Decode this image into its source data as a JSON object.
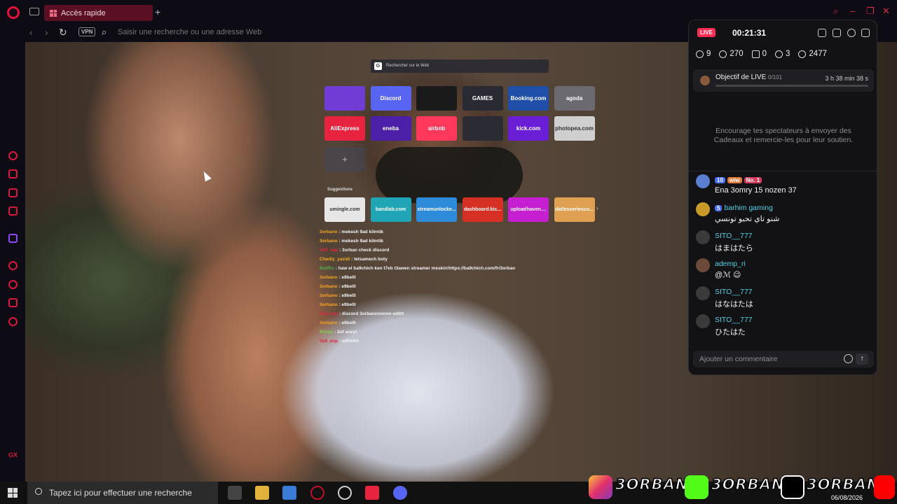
{
  "browser": {
    "tab_title": "Accès rapide",
    "new_tab": "+",
    "vpn": "VPN",
    "address_placeholder": "Saisir une recherche ou une adresse Web",
    "gx_label": "GX"
  },
  "speed_dial": {
    "search_text": "Rechercher sur le Web",
    "search_engine_glyph": "G",
    "tiles_row1": [
      {
        "label": "",
        "color": "#6f3cd6"
      },
      {
        "label": "Discord",
        "color": "#5865f2"
      },
      {
        "label": "",
        "color": "#1a1a1a"
      },
      {
        "label": "GAMES",
        "color": "#2a2a33"
      },
      {
        "label": "Booking.com",
        "color": "#1f4fa8"
      },
      {
        "label": "agoda",
        "color": "#6a6a70"
      }
    ],
    "tiles_row2": [
      {
        "label": "AliExpress",
        "color": "#e8233f"
      },
      {
        "label": "eneba",
        "color": "#4b1fa8"
      },
      {
        "label": "airbnb",
        "color": "#ff385c"
      },
      {
        "label": "",
        "color": "#2b2b33"
      },
      {
        "label": "kick.com",
        "color": "#6a1fd6"
      },
      {
        "label": "photopea.com",
        "color": "#cfcfcf"
      }
    ],
    "add_label": "+",
    "suggestions_label": "Suggestions",
    "suggestions": [
      {
        "label": "umingle.com",
        "color": "#e6e6e6"
      },
      {
        "label": "bandlab.com",
        "color": "#1fa5b5"
      },
      {
        "label": "streamunlocke...",
        "color": "#2e8bd9"
      },
      {
        "label": "dashboard.kic...",
        "color": "#d63024"
      },
      {
        "label": "uploadhaven....",
        "color": "#c51fd1"
      },
      {
        "label": "datlesseriesco...",
        "color": "#e0a052"
      }
    ],
    "next_arrow": "›"
  },
  "overlay_chat": [
    {
      "user": "3orbano",
      "user_color": "#f5a623",
      "text": ": mekesh 9ad kilmtik"
    },
    {
      "user": "3orbano",
      "user_color": "#f5a623",
      "text": ": mekesh 9ad kilmtik"
    },
    {
      "user": "Yefi_sep",
      "user_color": "#e8233f",
      "text": ": 3orban check discord"
    },
    {
      "user": "Chedly_yazidi",
      "user_color": "#f5a623",
      "text": ": tetsamech boty"
    },
    {
      "user": "BotRix",
      "user_color": "#4caf50",
      "text": ": haw el ba9chich ken t7eb t3awen streamer meskin!https://ba9chich.com/fr/3orban"
    },
    {
      "user": "3orbano",
      "user_color": "#f5a623",
      "text": ": e9belll"
    },
    {
      "user": "3orbano",
      "user_color": "#f5a623",
      "text": ": e9belll"
    },
    {
      "user": "3orbano",
      "user_color": "#f5a623",
      "text": ": e9belll"
    },
    {
      "user": "3orbano",
      "user_color": "#f5a623",
      "text": ": e9belll"
    },
    {
      "user": "Vell_esp",
      "user_color": "#e8233f",
      "text": ": discord 3orbannnnnnn edittt"
    },
    {
      "user": "3orbano",
      "user_color": "#f5a623",
      "text": ": e9belll"
    },
    {
      "user": "fkmsp",
      "user_color": "#7bd64a",
      "text": ": 3of aneyt"
    },
    {
      "user": "Vell_esp",
      "user_color": "#e8233f",
      "text": ": wllhhhh"
    }
  ],
  "live": {
    "badge": "LIVE",
    "timer": "00:21:31",
    "stats": {
      "viewers_a": "9",
      "views": "270",
      "gifts": "0",
      "shares": "3",
      "likes": "2477"
    },
    "goal": {
      "label": "Objectif de LIVE",
      "count": "0/101",
      "remaining": "3 h 38 min 38 s",
      "progress": 0.0
    },
    "encourage_text": "Encourage tes spectateurs à envoyer des Cadeaux et remercie-les pour leur soutien.",
    "comments": [
      {
        "name": "",
        "badges": [
          "10",
          "wiw",
          "No. 1"
        ],
        "msg": "Ena 3omry 15 nozen 37",
        "avatar_color": "#5a7fd0"
      },
      {
        "name": "barhim gaming",
        "badges": [
          "5"
        ],
        "msg": "شنو تاي تحبو تونسي",
        "avatar_color": "#c79a2a"
      },
      {
        "name": "SITO__777",
        "badges": [],
        "msg": "はまはたら",
        "avatar_color": "#3a3a3a"
      },
      {
        "name": "ademp_ri",
        "badges": [],
        "msg": "@ℳ 😉",
        "avatar_color": "#6b4a3a"
      },
      {
        "name": "SITO__777",
        "badges": [],
        "msg": "はなはたは",
        "avatar_color": "#3a3a3a"
      },
      {
        "name": "SITO__777",
        "badges": [],
        "msg": "ひたはた",
        "avatar_color": "#3a3a3a"
      }
    ],
    "input_placeholder": "Ajouter un commentaire",
    "send_glyph": "↑"
  },
  "taskbar": {
    "search_placeholder": "Tapez ici pour effectuer une recherche",
    "date": "06/08/2026"
  },
  "brand": {
    "name1": "3ORBAN",
    "name2": "3ORBAN",
    "name3": "3ORBAN"
  },
  "colors": {
    "accent": "#e3123a",
    "live": "#ff2d55",
    "username": "#4fd1e6"
  }
}
